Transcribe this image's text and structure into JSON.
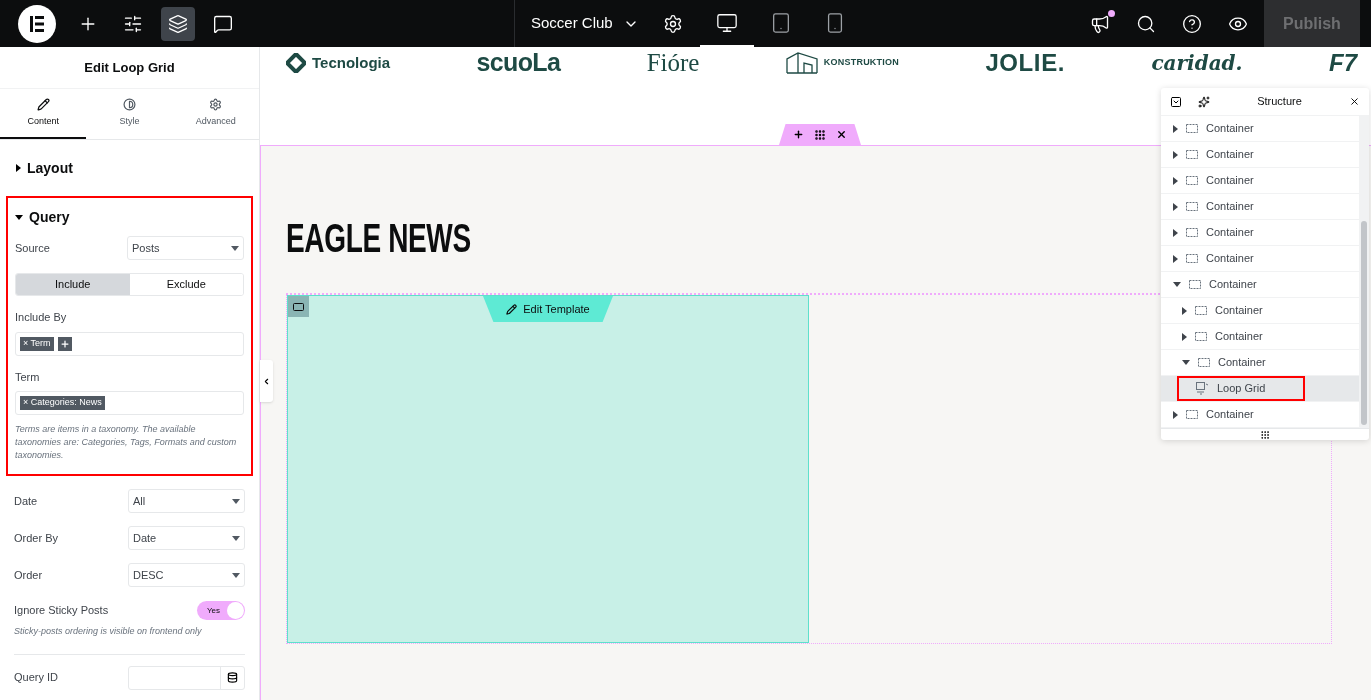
{
  "topbar": {
    "tools": [
      {
        "kind": "add",
        "selected": false
      },
      {
        "kind": "settings",
        "selected": false
      },
      {
        "kind": "layers",
        "selected": true
      },
      {
        "kind": "comments",
        "selected": false
      }
    ],
    "site_title": "Soccer Club",
    "devices": [
      {
        "kind": "desktop",
        "selected": true
      },
      {
        "kind": "tablet",
        "selected": false
      },
      {
        "kind": "mobile",
        "selected": false
      }
    ],
    "actions": [
      {
        "kind": "announcements",
        "notification": true
      },
      {
        "kind": "search",
        "notification": false
      },
      {
        "kind": "help",
        "notification": false
      },
      {
        "kind": "preview",
        "notification": false
      }
    ],
    "publish": {
      "label": "Publish",
      "disabled": true
    }
  },
  "panel": {
    "title": "Edit Loop Grid",
    "tabs": [
      {
        "label": "Content",
        "kind": "pencil",
        "selected": true
      },
      {
        "label": "Style",
        "kind": "contrast",
        "selected": false
      },
      {
        "label": "Advanced",
        "kind": "gear",
        "selected": false
      }
    ],
    "layout_section": {
      "title": "Layout",
      "expanded": false
    },
    "query_section": {
      "title": "Query",
      "expanded": true,
      "highlighted": true,
      "source": {
        "label": "Source",
        "value": "Posts"
      },
      "include_exclude": [
        {
          "label": "Include",
          "selected": true
        },
        {
          "label": "Exclude",
          "selected": false
        }
      ],
      "include_by": {
        "label": "Include By",
        "tags": [
          {
            "remove": "×",
            "label": "Term"
          }
        ]
      },
      "term": {
        "label": "Term",
        "tags": [
          {
            "remove": "×",
            "label": "Categories: News"
          }
        ]
      },
      "help": "Terms are items in a taxonomy. The available taxonomies are: Categories, Tags, Formats and custom taxonomies."
    },
    "selects": [
      {
        "label": "Date",
        "value": "All"
      },
      {
        "label": "Order By",
        "value": "Date"
      },
      {
        "label": "Order",
        "value": "DESC"
      }
    ],
    "sticky": {
      "label": "Ignore Sticky Posts",
      "on": true,
      "on_label": "Yes",
      "note": "Sticky-posts ordering is visible on frontend only"
    },
    "query_id": {
      "label": "Query ID"
    }
  },
  "canvas": {
    "logos": [
      "Tecnologia",
      "scuoLa",
      "Fióre",
      "KONSTRUKTION",
      "JOLIE.",
      "caridad.",
      "F7"
    ],
    "heading": "EAGLE NEWS",
    "edit_template": "Edit Template"
  },
  "structure": {
    "title": "Structure",
    "items": [
      {
        "label": "Container",
        "kind": "container",
        "expanded": false,
        "selected": false,
        "highlighted": false
      },
      {
        "label": "Container",
        "kind": "container",
        "expanded": false,
        "selected": false,
        "highlighted": false
      },
      {
        "label": "Container",
        "kind": "container",
        "expanded": false,
        "selected": false,
        "highlighted": false
      },
      {
        "label": "Container",
        "kind": "container",
        "expanded": false,
        "selected": false,
        "highlighted": false
      },
      {
        "label": "Container",
        "kind": "container",
        "expanded": false,
        "selected": false,
        "highlighted": false
      },
      {
        "label": "Container",
        "kind": "container",
        "expanded": false,
        "selected": false,
        "highlighted": false
      },
      {
        "label": "Container",
        "kind": "container",
        "expanded": true,
        "selected": false,
        "highlighted": false,
        "children": [
          {
            "label": "Container",
            "kind": "container",
            "expanded": false,
            "selected": false,
            "highlighted": false
          },
          {
            "label": "Container",
            "kind": "container",
            "expanded": false,
            "selected": false,
            "highlighted": false
          },
          {
            "label": "Container",
            "kind": "container",
            "expanded": true,
            "selected": false,
            "highlighted": false,
            "children": [
              {
                "label": "Loop Grid",
                "kind": "widget",
                "selected": true,
                "highlighted": true
              }
            ]
          }
        ]
      },
      {
        "label": "Container",
        "kind": "container",
        "expanded": false,
        "selected": false,
        "highlighted": false
      }
    ]
  }
}
